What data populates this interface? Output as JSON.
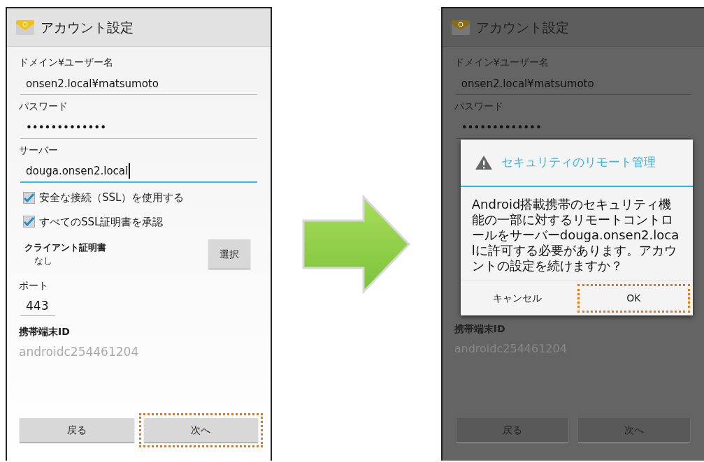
{
  "screens": [
    {
      "title": "アカウント設定",
      "dimmed": false,
      "fields": [
        {
          "label": "ドメイン¥ユーザー名",
          "value": "onsen2.local¥matsumoto",
          "focused": false
        },
        {
          "label": "パスワード",
          "value": "•••••••••••••",
          "focused": false
        },
        {
          "label": "サーバー",
          "value": "douga.onsen2.local",
          "focused": true
        }
      ],
      "checkboxes": [
        {
          "label": "安全な接続（SSL）を使用する",
          "checked": true
        },
        {
          "label": "すべてのSSL証明書を承認",
          "checked": true
        }
      ],
      "client_cert": {
        "label": "クライアント証明書",
        "value": "なし",
        "button": "選択"
      },
      "port": {
        "label": "ポート",
        "value": "443"
      },
      "device_id": {
        "label": "携帯端末ID",
        "value": "androidc254461204"
      },
      "buttons": [
        {
          "label": "戻る",
          "highlighted": false
        },
        {
          "label": "次へ",
          "highlighted": true
        }
      ]
    },
    {
      "title": "アカウント設定",
      "dimmed": true,
      "fields": [
        {
          "label": "ドメイン¥ユーザー名",
          "value": "onsen2.local¥matsumoto",
          "focused": false
        },
        {
          "label": "パスワード",
          "value": "•••••••••••••",
          "focused": false
        }
      ],
      "device_id": {
        "label": "携帯端末ID",
        "value": "androidc254461204"
      },
      "buttons": [
        {
          "label": "戻る",
          "highlighted": false
        },
        {
          "label": "次へ",
          "highlighted": false
        }
      ],
      "dialog": {
        "title": "セキュリティのリモート管理",
        "message": "Android搭載携帯のセキュリティ機能の一部に対するリモートコントロールをサーバーdouga.onsen2.localに許可する必要があります。アカウントの設定を続けますか？",
        "buttons": [
          {
            "label": "キャンセル",
            "highlighted": false
          },
          {
            "label": "OK",
            "highlighted": true
          }
        ]
      }
    }
  ]
}
